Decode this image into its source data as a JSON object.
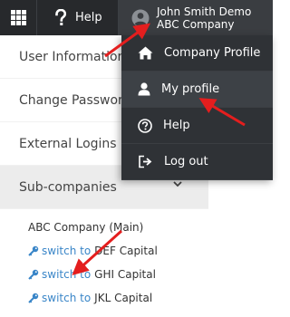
{
  "topbar": {
    "apps_icon": "grid-icon",
    "help_icon": "question-icon",
    "help_label": "Help",
    "user_icon": "user-icon",
    "user_name": "John Smith Demo",
    "company_name": "ABC Company"
  },
  "side_menu": {
    "items": [
      {
        "label": "User Information"
      },
      {
        "label": "Change Password"
      },
      {
        "label": "External Logins"
      },
      {
        "label": "Sub-companies",
        "expanded": true
      }
    ]
  },
  "sub_companies": {
    "main": "ABC Company (Main)",
    "switch_label": "switch to",
    "items": [
      {
        "name": "DEF Capital"
      },
      {
        "name": "GHI Capital"
      },
      {
        "name": "JKL Capital"
      }
    ]
  },
  "user_dropdown": {
    "items": [
      {
        "label": "Company Profile",
        "icon": "home-icon"
      },
      {
        "label": "My profile",
        "icon": "user-icon",
        "active": true
      },
      {
        "label": "Help",
        "icon": "question-circle-icon"
      },
      {
        "label": "Log out",
        "icon": "logout-icon"
      }
    ]
  },
  "colors": {
    "topbar_bg": "#27292c",
    "dropdown_bg": "#2f3236",
    "link_blue": "#3a86c8",
    "annotation_red": "#e41e1e"
  }
}
